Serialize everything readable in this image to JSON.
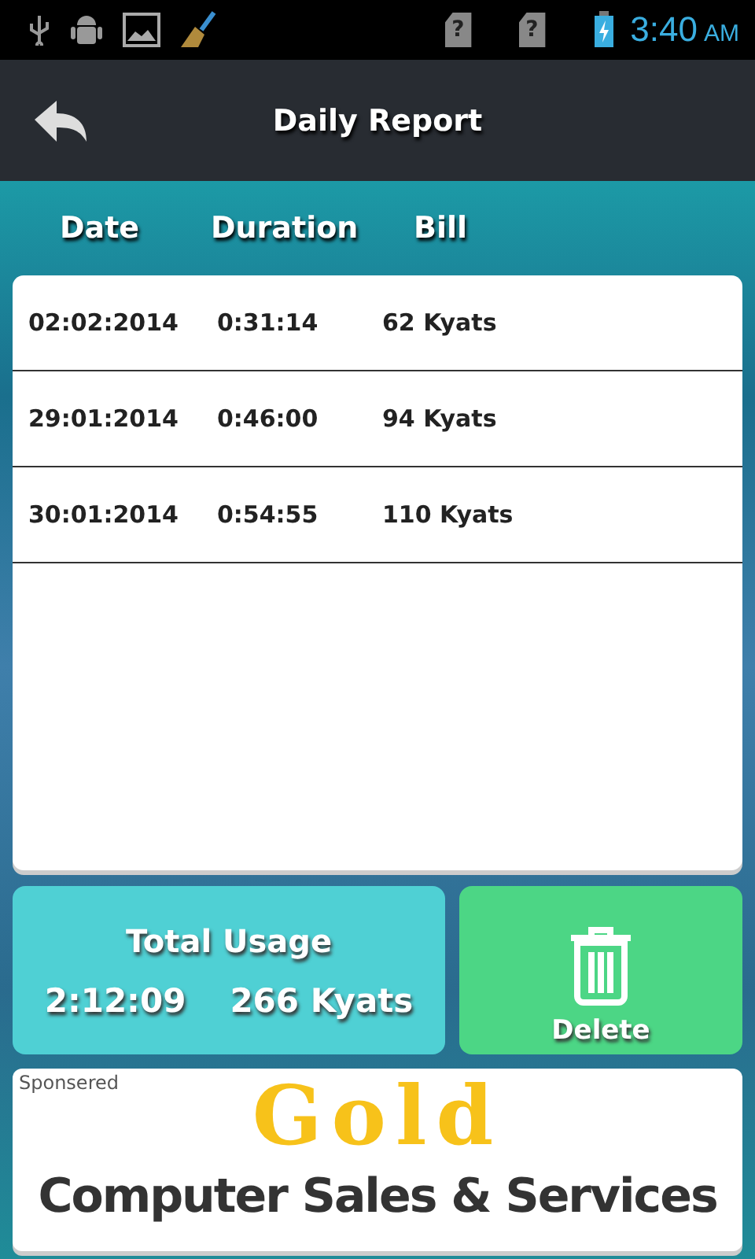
{
  "status_bar": {
    "sim_marks": [
      "?",
      "?"
    ],
    "time": "3:40",
    "meridiem": "AM"
  },
  "action_bar": {
    "title": "Daily Report"
  },
  "table": {
    "columns": [
      "Date",
      "Duration",
      "Bill"
    ],
    "rows": [
      [
        "02:02:2014",
        "0:31:14",
        "62 Kyats"
      ],
      [
        "29:01:2014",
        "0:46:00",
        "94 Kyats"
      ],
      [
        "30:01:2014",
        "0:54:55",
        "110 Kyats"
      ]
    ]
  },
  "total": {
    "label": "Total Usage",
    "duration": "2:12:09",
    "bill": "266 Kyats"
  },
  "delete_button": {
    "label": "Delete"
  },
  "ad": {
    "tag": "Sponsered",
    "brand": "Gold",
    "tagline": "Computer Sales & Services"
  }
}
